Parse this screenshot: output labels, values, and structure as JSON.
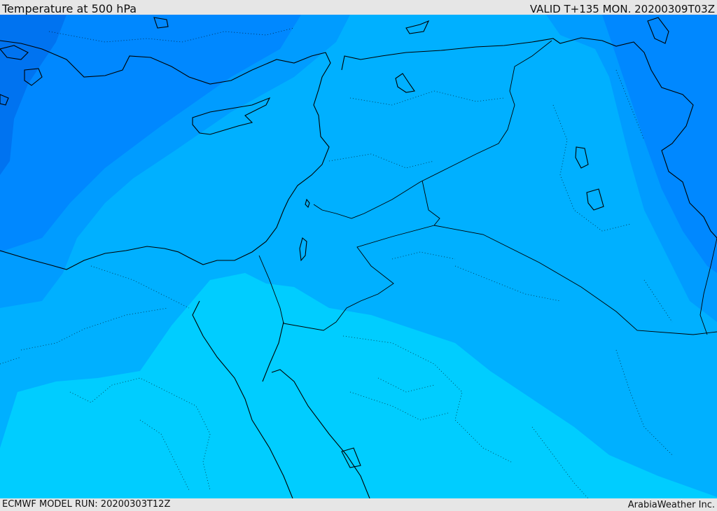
{
  "header": {
    "title": "Temperature at 500 hPa",
    "valid": "VALID T+135 MON. 20200309T03Z"
  },
  "footer": {
    "model_run": "ECMWF MODEL RUN: 20200303T12Z",
    "credit": "ArabiaWeather Inc."
  },
  "colors": {
    "coldest": "#0073f0",
    "cold": "#0088ff",
    "mid": "#009cff",
    "cool": "#00b0ff",
    "warm": "#00cdff",
    "lines": "#000000"
  }
}
